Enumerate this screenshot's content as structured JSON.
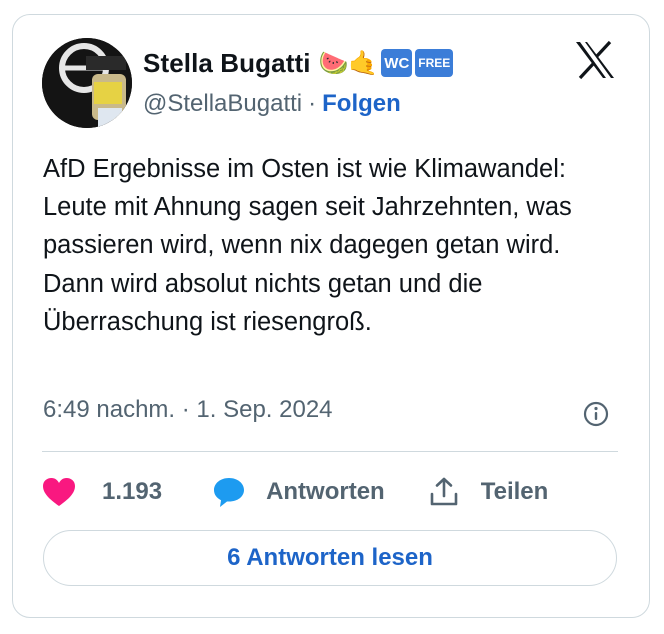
{
  "author": {
    "name": "Stella Bugatti",
    "emoji": "🍉🤙",
    "badge_wc": "WC",
    "badge_free": "FREE",
    "handle": "@StellaBugatti",
    "separator": "·",
    "follow_label": "Folgen"
  },
  "tweet": {
    "text": "AfD Ergebnisse im Osten ist wie Klimawandel: Leute mit Ahnung sagen seit Jahrzehnten, was passieren wird, wenn nix dagegen getan wird. Dann wird absolut nichts getan und die Überraschung ist riesengroß.",
    "timestamp": "6:49 nachm. · 1. Sep. 2024"
  },
  "actions": {
    "like_count": "1.193",
    "reply_label": "Antworten",
    "share_label": "Teilen"
  },
  "read_replies_label": "6 Antworten lesen",
  "colors": {
    "link": "#1d64c8",
    "like": "#f91880",
    "reply": "#1d9bf0",
    "muted": "#536471",
    "border": "#cfd9de"
  },
  "icons": [
    "avatar",
    "x-logo-icon",
    "info-icon",
    "heart-icon",
    "speech-bubble-icon",
    "share-icon"
  ]
}
